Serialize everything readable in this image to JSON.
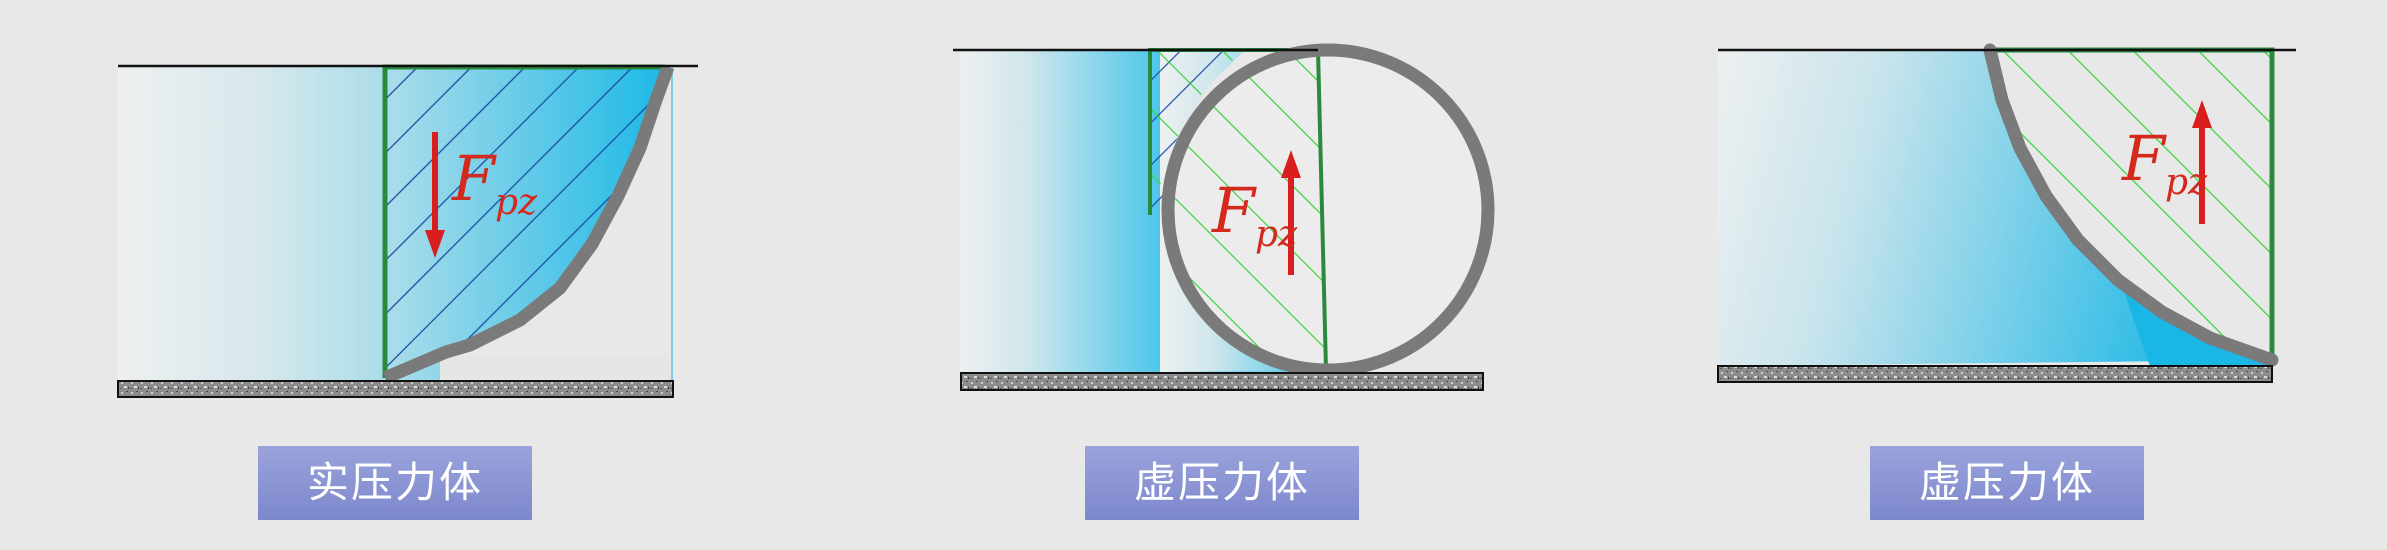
{
  "panels": [
    {
      "force_symbol": "F",
      "force_subscript": "pz",
      "force_direction": "down",
      "caption": "实压力体"
    },
    {
      "force_symbol": "F",
      "force_subscript": "pz",
      "force_direction": "up",
      "caption": "虚压力体"
    },
    {
      "force_symbol": "F",
      "force_subscript": "pz",
      "force_direction": "up",
      "caption": "虚压力体"
    }
  ],
  "colors": {
    "background": "#e8e8e8",
    "water_light": "#eef0f0",
    "water_deep": "#1ab8e6",
    "wall": "#7a7a7a",
    "hatch_blue": "#1b4fa3",
    "hatch_green": "#33d633",
    "outline_green": "#2a8a3c",
    "force_arrow": "#d81e1e",
    "caption_bg": "#8a94d4"
  }
}
